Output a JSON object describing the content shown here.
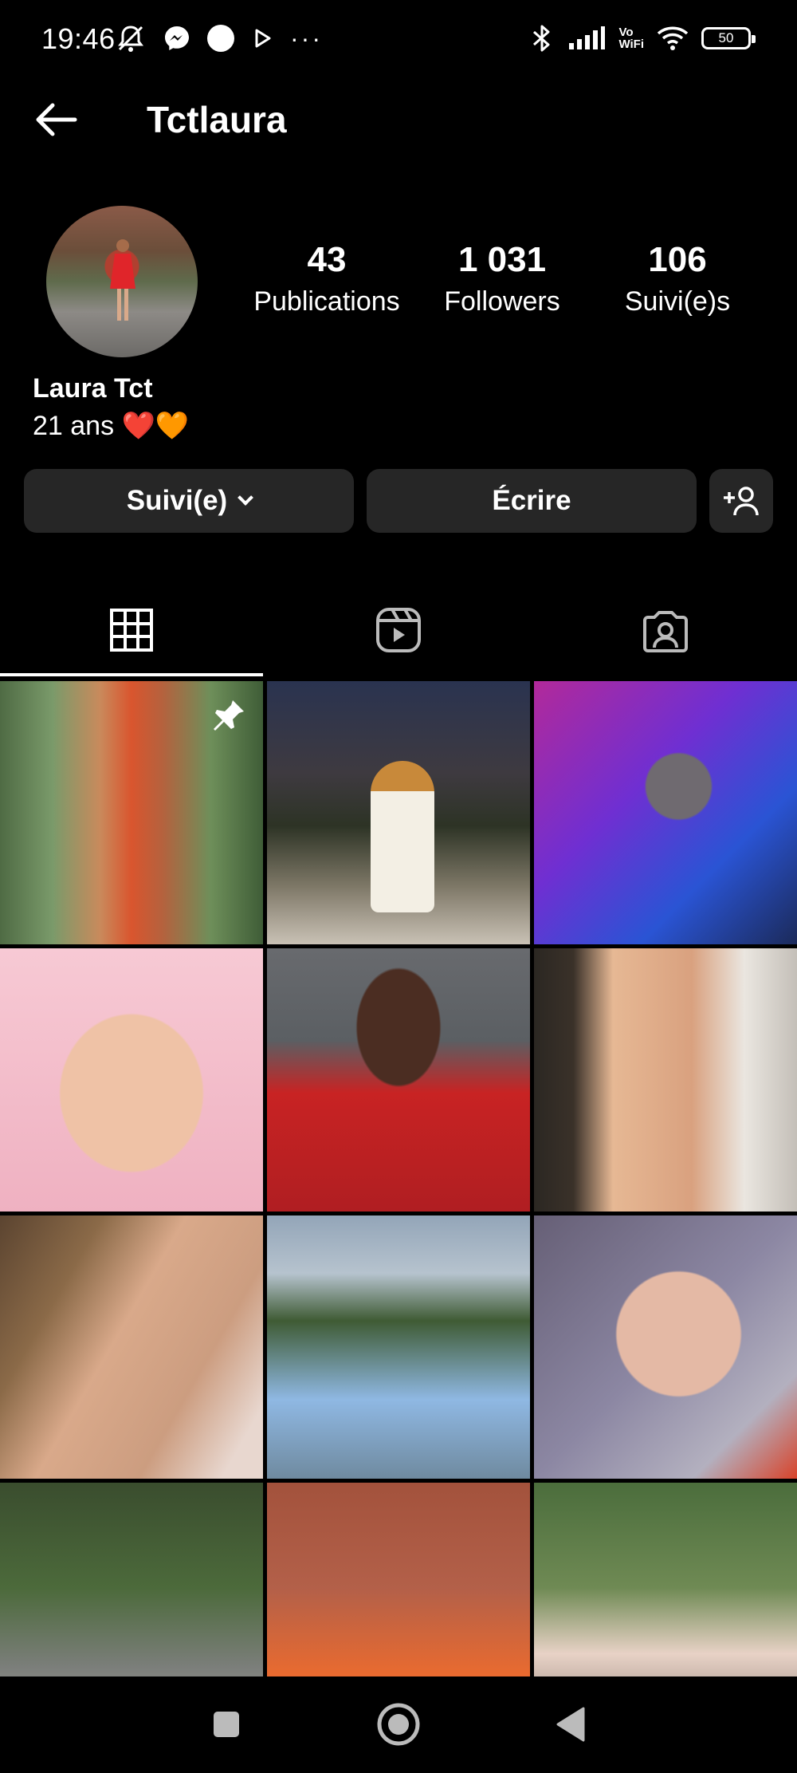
{
  "status_bar": {
    "time": "19:46",
    "battery": "50",
    "vowifi_line1": "Vo",
    "vowifi_line2": "WiFi",
    "more": "···",
    "left_icons": [
      "mute-vibrate-icon",
      "messenger-icon",
      "circle-notification-icon",
      "play-store-icon",
      "more-dots-icon"
    ],
    "right_icons": [
      "bluetooth-icon",
      "signal-icon",
      "vowifi-icon",
      "wifi-icon",
      "battery-icon"
    ]
  },
  "header": {
    "title": "Tctlaura",
    "back_icon": "arrow-left-icon"
  },
  "profile": {
    "name": "Laura Tct",
    "bio": "21 ans ❤️🧡",
    "stats": [
      {
        "value": "43",
        "label": "Publications"
      },
      {
        "value": "1 031",
        "label": "Followers"
      },
      {
        "value": "106",
        "label": "Suivi(e)s"
      }
    ]
  },
  "actions": {
    "follow_label": "Suivi(e)",
    "message_label": "Écrire",
    "add_user_icon": "add-user-icon"
  },
  "tabs": [
    {
      "name": "grid",
      "icon": "grid-icon",
      "active": true
    },
    {
      "name": "reels",
      "icon": "reels-icon",
      "active": false
    },
    {
      "name": "tagged",
      "icon": "tagged-icon",
      "active": false
    }
  ],
  "grid": {
    "post_count_visible": 12,
    "pinned_first": true
  },
  "navbar": {
    "icons": [
      "recent-apps-icon",
      "home-icon",
      "back-icon"
    ]
  },
  "colors": {
    "background": "#000000",
    "button": "#262626",
    "text": "#ffffff"
  }
}
